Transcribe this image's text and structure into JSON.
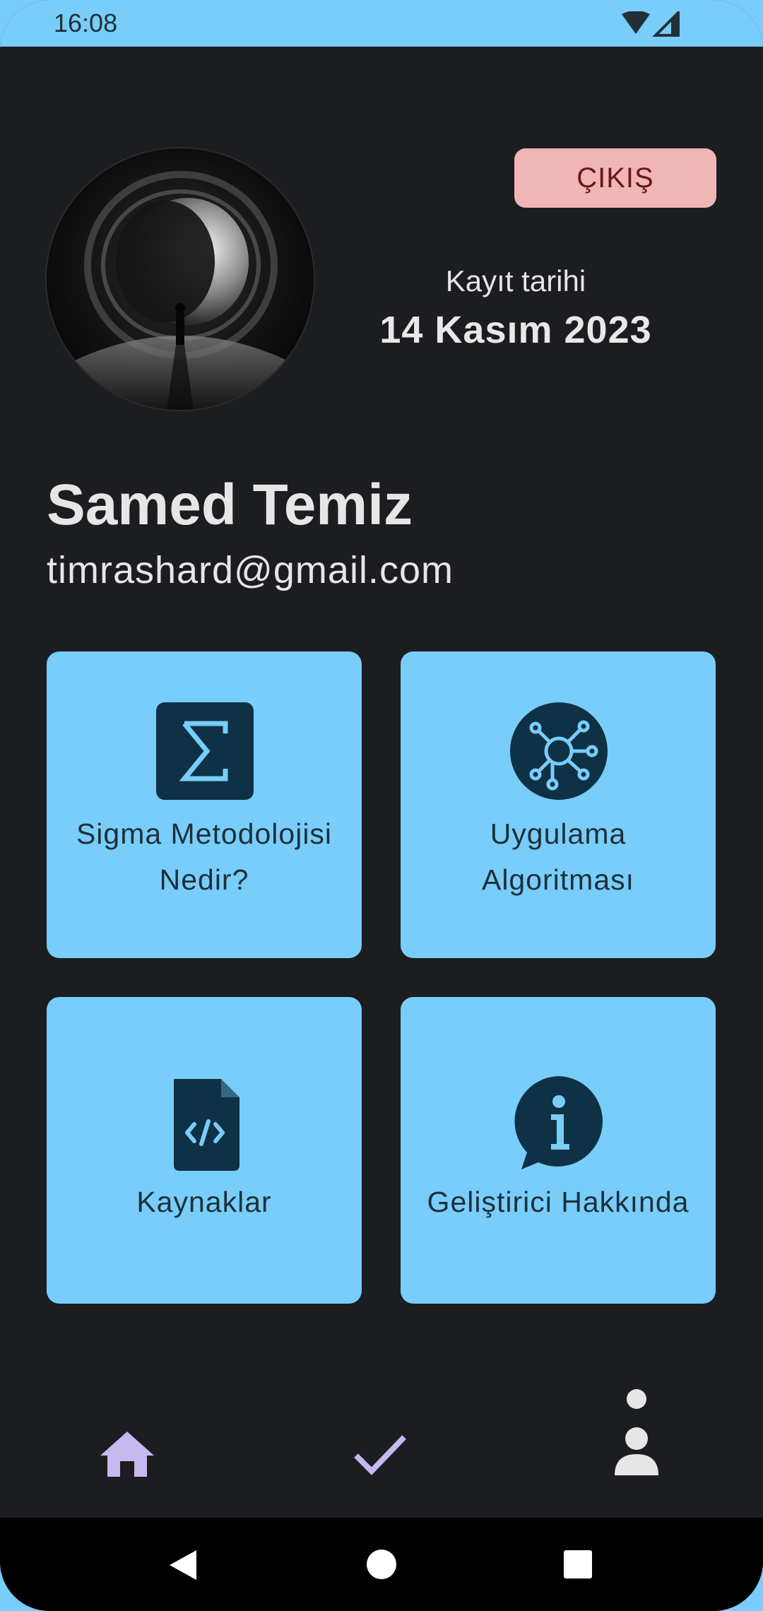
{
  "status_bar": {
    "time": "16:08"
  },
  "profile": {
    "logout_label": "ÇIKIŞ",
    "registration_label": "Kayıt tarihi",
    "registration_date": "14 Kasım 2023",
    "name": "Samed Temiz",
    "email": "timrashard@gmail.com"
  },
  "cards": [
    {
      "label_line1": "Sigma Metodolojisi",
      "label_line2": "Nedir?",
      "icon": "sigma-icon"
    },
    {
      "label_line1": "Uygulama",
      "label_line2": "Algoritması",
      "icon": "network-hub-icon"
    },
    {
      "label": "Kaynaklar",
      "icon": "code-file-icon"
    },
    {
      "label": "Geliştirici Hakkında",
      "icon": "info-bubble-icon"
    }
  ],
  "bottom_nav": {
    "items": [
      {
        "icon": "home-icon"
      },
      {
        "icon": "check-icon"
      },
      {
        "icon": "person-icon"
      }
    ]
  },
  "colors": {
    "background": "#1b1d20",
    "accent": "#78cdfa",
    "logout_bg": "#f0b6b6",
    "nav_active": "#c7b8f0"
  }
}
